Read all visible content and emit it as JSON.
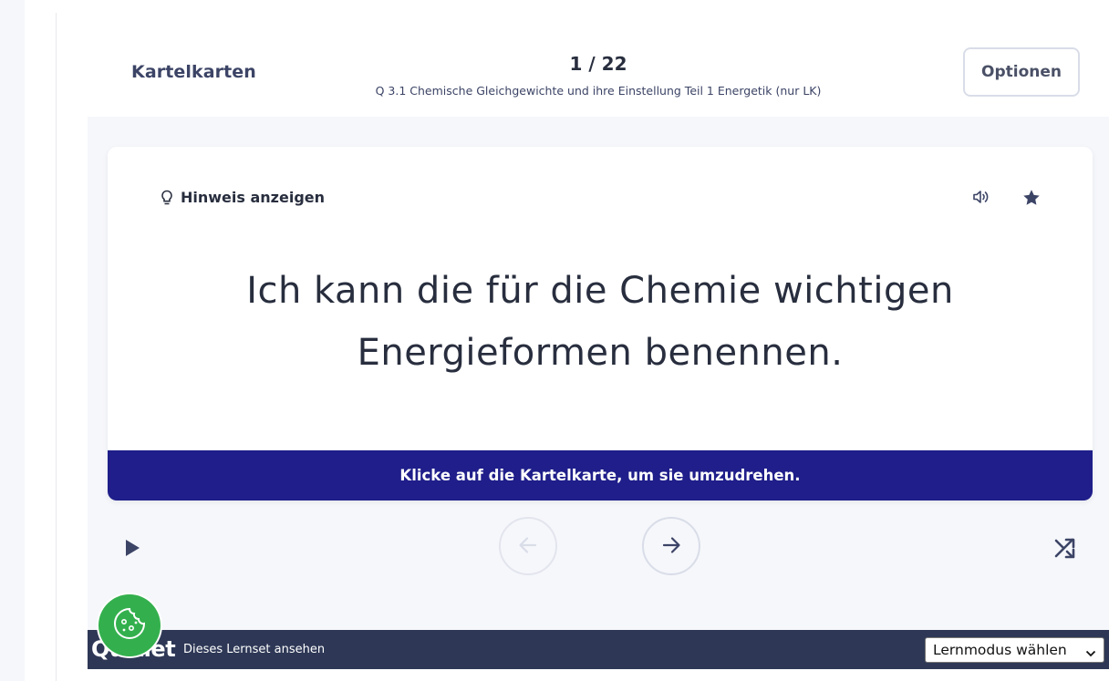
{
  "header": {
    "mode_title": "Kartelkarten",
    "counter": "1 / 22",
    "set_title": "Q 3.1 Chemische Gleichgewichte und ihre Einstellung Teil 1 Energetik (nur LK)",
    "options_label": "Optionen"
  },
  "card": {
    "hint_label": "Hinweis anzeigen",
    "term": "Ich kann die für die Chemie wichtigen Energieformen benennen.",
    "flip_hint": "Klicke auf die Kartelkarte, um sie umzudrehen.",
    "icons": [
      "lightbulb-icon",
      "audio-icon",
      "star-icon"
    ]
  },
  "controls": {
    "icons": [
      "play-icon",
      "arrow-left-icon",
      "arrow-right-icon",
      "shuffle-icon"
    ]
  },
  "embed_bar": {
    "brand": "Quizlet",
    "link_text": "Dieses Lernset ansehen",
    "mode_select_value": "Lernmodus wählen"
  },
  "colors": {
    "banner": "#1f1e8a",
    "embed_bar": "#2e3856",
    "cookie_button": "#33b04d",
    "stage_background": "#f6f7fb"
  }
}
